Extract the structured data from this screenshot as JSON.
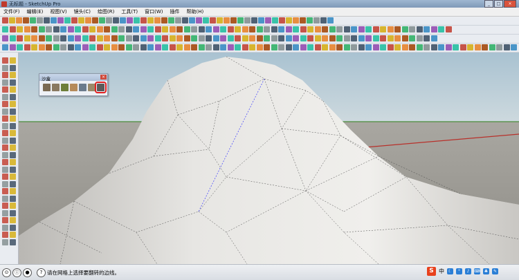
{
  "window": {
    "title": "无标题 - SketchUp Pro"
  },
  "menu": [
    "文件(F)",
    "编辑(E)",
    "视图(V)",
    "镜头(C)",
    "绘图(R)",
    "工具(T)",
    "窗口(W)",
    "插件",
    "帮助(H)"
  ],
  "sandbox_panel": {
    "title": "沙盒",
    "tools": [
      "contour-sandbox-tool-icon",
      "grid-sandbox-tool-icon",
      "smoove-tool-icon",
      "stamp-tool-icon",
      "drape-tool-icon",
      "add-detail-tool-icon",
      "flip-edge-tool-icon"
    ],
    "highlighted_tool": "flip-edge-tool-icon"
  },
  "status": {
    "message": "请在网格上选择要翻转的边线。"
  },
  "ime": {
    "logo": "S",
    "lang": "中"
  },
  "colors": {
    "sky": "#b4ccd8",
    "ground": "#9c9a94",
    "terrain": "#d9d7d3",
    "highlight": "#e02020",
    "selected_edge": "#3a3aff"
  }
}
